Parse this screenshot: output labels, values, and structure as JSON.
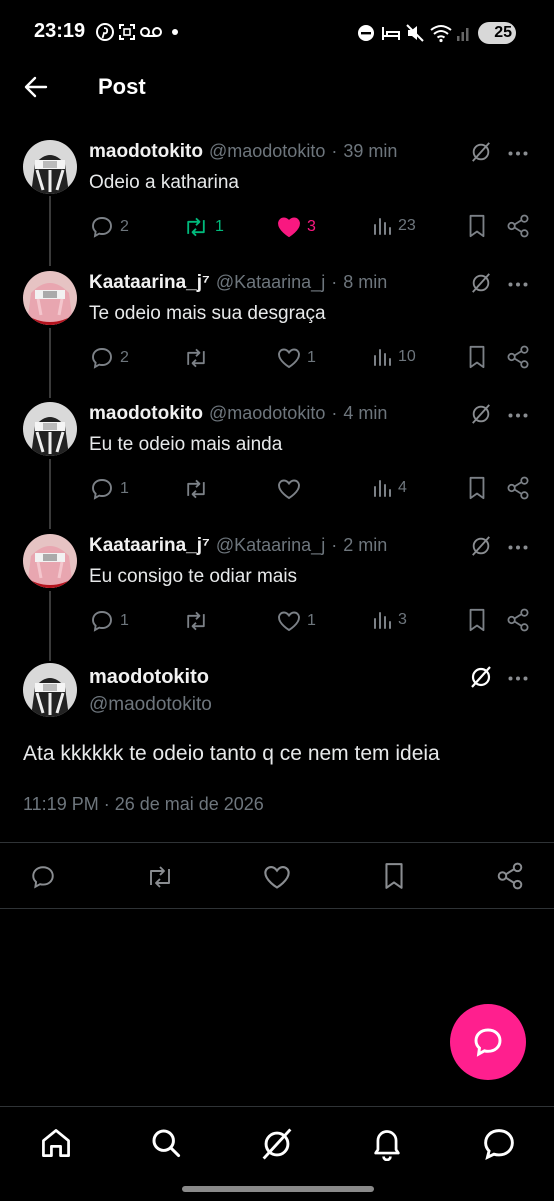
{
  "status_bar": {
    "time": "23:19",
    "battery": "25",
    "left_icons": [
      "pinterest-icon",
      "screenshot-icon",
      "voicemail-icon",
      "dot-icon"
    ],
    "right_icons": [
      "do-not-disturb-icon",
      "sleep-icon",
      "mute-icon",
      "wifi-icon",
      "signal-icon"
    ]
  },
  "header": {
    "title": "Post"
  },
  "thread": [
    {
      "name": "maodotokito",
      "handle": "@maodotokito",
      "time": "39 min",
      "text": "Odeio a katharina",
      "replies": "2",
      "reposts": "1",
      "likes": "3",
      "views": "23",
      "reposted": true,
      "liked": true
    },
    {
      "name": "Kaataarina_j⁷",
      "handle": "@Kataarina_j",
      "time": "8 min",
      "text": "Te odeio mais sua desgraça",
      "replies": "2",
      "reposts": "",
      "likes": "1",
      "views": "10",
      "reposted": false,
      "liked": false
    },
    {
      "name": "maodotokito",
      "handle": "@maodotokito",
      "time": "4 min",
      "text": "Eu te odeio mais ainda",
      "replies": "1",
      "reposts": "",
      "likes": "",
      "views": "4",
      "reposted": false,
      "liked": false
    },
    {
      "name": "Kaataarina_j⁷",
      "handle": "@Kataarina_j",
      "time": "2 min",
      "text": "Eu consigo te odiar mais",
      "replies": "1",
      "reposts": "",
      "likes": "1",
      "views": "3",
      "reposted": false,
      "liked": false
    }
  ],
  "main_post": {
    "name": "maodotokito",
    "handle": "@maodotokito",
    "text": "Ata kkkkkk te odeio tanto q ce nem tem ideia",
    "timestamp": "11:19 PM · 26 de mai de 2026"
  },
  "colors": {
    "accent_pink": "#ff1f8e",
    "like_pink": "#f91880",
    "repost_green": "#00ba7c",
    "muted": "#6e767d"
  },
  "bottom_nav": [
    "home-icon",
    "search-icon",
    "grok-icon",
    "notifications-icon",
    "messages-icon"
  ]
}
